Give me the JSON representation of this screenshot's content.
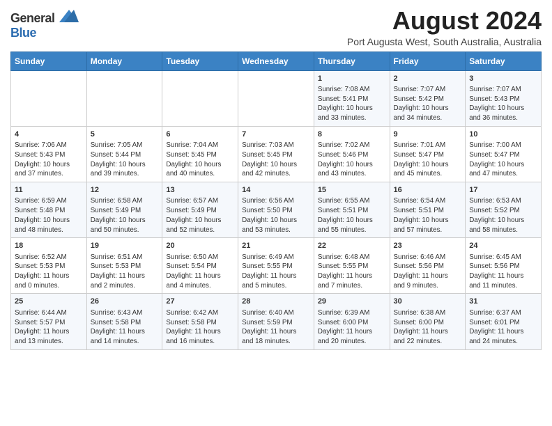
{
  "header": {
    "logo_general": "General",
    "logo_blue": "Blue",
    "month_title": "August 2024",
    "subtitle": "Port Augusta West, South Australia, Australia"
  },
  "days_of_week": [
    "Sunday",
    "Monday",
    "Tuesday",
    "Wednesday",
    "Thursday",
    "Friday",
    "Saturday"
  ],
  "weeks": [
    [
      {
        "day": "",
        "info": ""
      },
      {
        "day": "",
        "info": ""
      },
      {
        "day": "",
        "info": ""
      },
      {
        "day": "",
        "info": ""
      },
      {
        "day": "1",
        "info": "Sunrise: 7:08 AM\nSunset: 5:41 PM\nDaylight: 10 hours\nand 33 minutes."
      },
      {
        "day": "2",
        "info": "Sunrise: 7:07 AM\nSunset: 5:42 PM\nDaylight: 10 hours\nand 34 minutes."
      },
      {
        "day": "3",
        "info": "Sunrise: 7:07 AM\nSunset: 5:43 PM\nDaylight: 10 hours\nand 36 minutes."
      }
    ],
    [
      {
        "day": "4",
        "info": "Sunrise: 7:06 AM\nSunset: 5:43 PM\nDaylight: 10 hours\nand 37 minutes."
      },
      {
        "day": "5",
        "info": "Sunrise: 7:05 AM\nSunset: 5:44 PM\nDaylight: 10 hours\nand 39 minutes."
      },
      {
        "day": "6",
        "info": "Sunrise: 7:04 AM\nSunset: 5:45 PM\nDaylight: 10 hours\nand 40 minutes."
      },
      {
        "day": "7",
        "info": "Sunrise: 7:03 AM\nSunset: 5:45 PM\nDaylight: 10 hours\nand 42 minutes."
      },
      {
        "day": "8",
        "info": "Sunrise: 7:02 AM\nSunset: 5:46 PM\nDaylight: 10 hours\nand 43 minutes."
      },
      {
        "day": "9",
        "info": "Sunrise: 7:01 AM\nSunset: 5:47 PM\nDaylight: 10 hours\nand 45 minutes."
      },
      {
        "day": "10",
        "info": "Sunrise: 7:00 AM\nSunset: 5:47 PM\nDaylight: 10 hours\nand 47 minutes."
      }
    ],
    [
      {
        "day": "11",
        "info": "Sunrise: 6:59 AM\nSunset: 5:48 PM\nDaylight: 10 hours\nand 48 minutes."
      },
      {
        "day": "12",
        "info": "Sunrise: 6:58 AM\nSunset: 5:49 PM\nDaylight: 10 hours\nand 50 minutes."
      },
      {
        "day": "13",
        "info": "Sunrise: 6:57 AM\nSunset: 5:49 PM\nDaylight: 10 hours\nand 52 minutes."
      },
      {
        "day": "14",
        "info": "Sunrise: 6:56 AM\nSunset: 5:50 PM\nDaylight: 10 hours\nand 53 minutes."
      },
      {
        "day": "15",
        "info": "Sunrise: 6:55 AM\nSunset: 5:51 PM\nDaylight: 10 hours\nand 55 minutes."
      },
      {
        "day": "16",
        "info": "Sunrise: 6:54 AM\nSunset: 5:51 PM\nDaylight: 10 hours\nand 57 minutes."
      },
      {
        "day": "17",
        "info": "Sunrise: 6:53 AM\nSunset: 5:52 PM\nDaylight: 10 hours\nand 58 minutes."
      }
    ],
    [
      {
        "day": "18",
        "info": "Sunrise: 6:52 AM\nSunset: 5:53 PM\nDaylight: 11 hours\nand 0 minutes."
      },
      {
        "day": "19",
        "info": "Sunrise: 6:51 AM\nSunset: 5:53 PM\nDaylight: 11 hours\nand 2 minutes."
      },
      {
        "day": "20",
        "info": "Sunrise: 6:50 AM\nSunset: 5:54 PM\nDaylight: 11 hours\nand 4 minutes."
      },
      {
        "day": "21",
        "info": "Sunrise: 6:49 AM\nSunset: 5:55 PM\nDaylight: 11 hours\nand 5 minutes."
      },
      {
        "day": "22",
        "info": "Sunrise: 6:48 AM\nSunset: 5:55 PM\nDaylight: 11 hours\nand 7 minutes."
      },
      {
        "day": "23",
        "info": "Sunrise: 6:46 AM\nSunset: 5:56 PM\nDaylight: 11 hours\nand 9 minutes."
      },
      {
        "day": "24",
        "info": "Sunrise: 6:45 AM\nSunset: 5:56 PM\nDaylight: 11 hours\nand 11 minutes."
      }
    ],
    [
      {
        "day": "25",
        "info": "Sunrise: 6:44 AM\nSunset: 5:57 PM\nDaylight: 11 hours\nand 13 minutes."
      },
      {
        "day": "26",
        "info": "Sunrise: 6:43 AM\nSunset: 5:58 PM\nDaylight: 11 hours\nand 14 minutes."
      },
      {
        "day": "27",
        "info": "Sunrise: 6:42 AM\nSunset: 5:58 PM\nDaylight: 11 hours\nand 16 minutes."
      },
      {
        "day": "28",
        "info": "Sunrise: 6:40 AM\nSunset: 5:59 PM\nDaylight: 11 hours\nand 18 minutes."
      },
      {
        "day": "29",
        "info": "Sunrise: 6:39 AM\nSunset: 6:00 PM\nDaylight: 11 hours\nand 20 minutes."
      },
      {
        "day": "30",
        "info": "Sunrise: 6:38 AM\nSunset: 6:00 PM\nDaylight: 11 hours\nand 22 minutes."
      },
      {
        "day": "31",
        "info": "Sunrise: 6:37 AM\nSunset: 6:01 PM\nDaylight: 11 hours\nand 24 minutes."
      }
    ]
  ]
}
